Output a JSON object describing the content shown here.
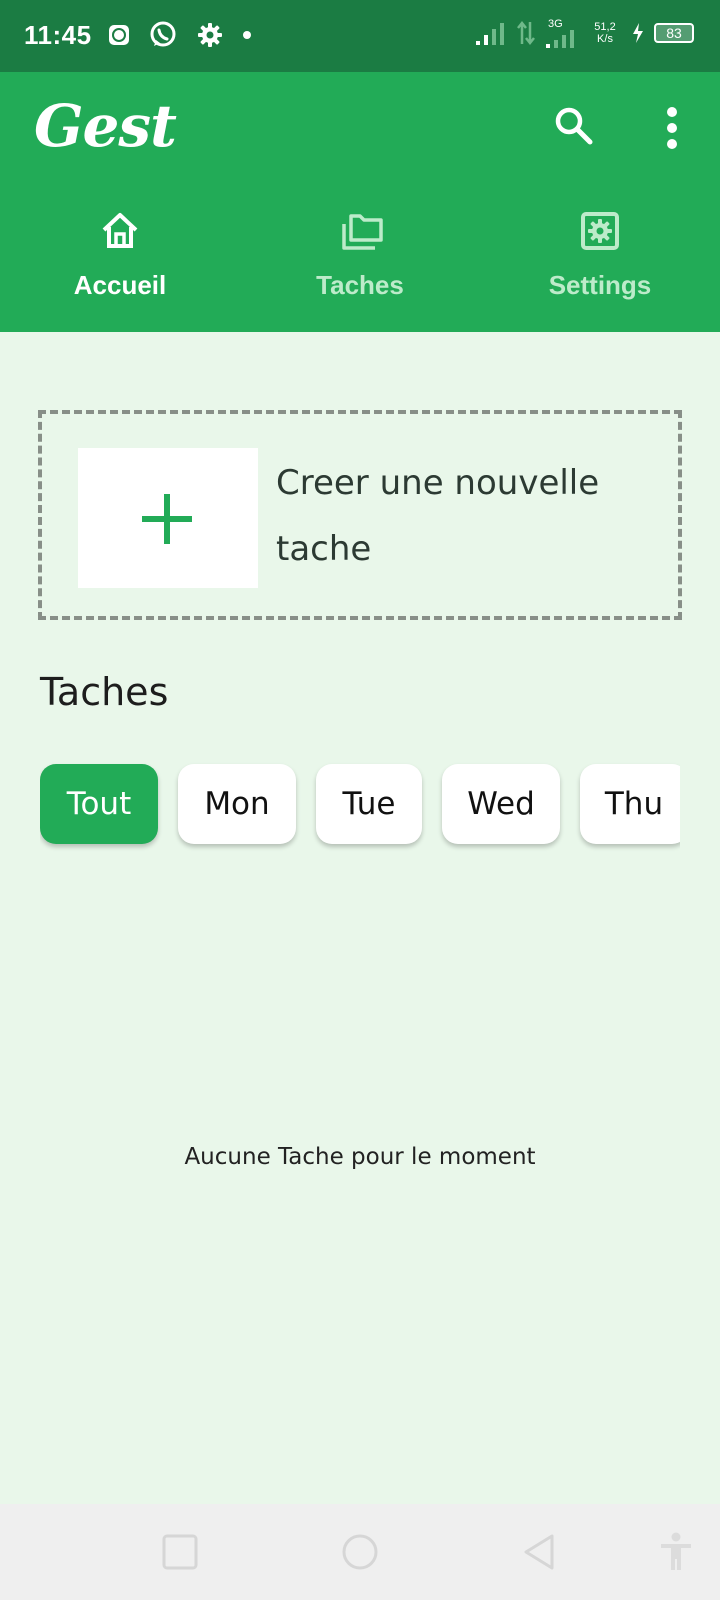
{
  "status_bar": {
    "time": "11:45",
    "network_type": "3G",
    "speed_value": "51,2",
    "speed_unit": "K/s",
    "battery": "83"
  },
  "app_bar": {
    "logo_text": "Gest",
    "tabs": [
      {
        "label": "Accueil",
        "icon": "home-icon",
        "active": true
      },
      {
        "label": "Taches",
        "icon": "folders-icon",
        "active": false
      },
      {
        "label": "Settings",
        "icon": "settings-icon",
        "active": false
      }
    ]
  },
  "create_card": {
    "line1": "Creer une nouvelle",
    "line2": "tache"
  },
  "tasks_section": {
    "title": "Taches",
    "filters": [
      {
        "label": "Tout",
        "active": true
      },
      {
        "label": "Mon",
        "active": false
      },
      {
        "label": "Tue",
        "active": false
      },
      {
        "label": "Wed",
        "active": false
      },
      {
        "label": "Thu",
        "active": false
      }
    ],
    "empty_message": "Aucune Tache pour le moment"
  },
  "colors": {
    "primary": "#22ab57",
    "status_bar": "#1b7c43",
    "background": "#e9f7ea"
  }
}
